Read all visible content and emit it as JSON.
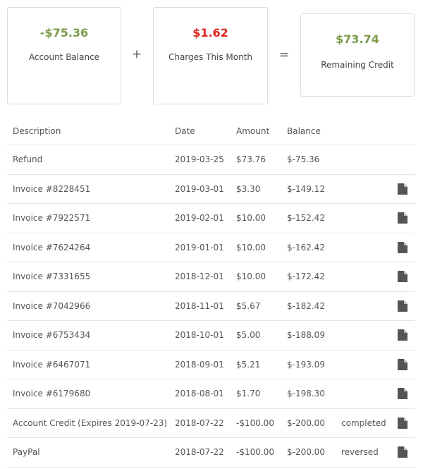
{
  "summary": {
    "account_balance": {
      "amount": "-$75.36",
      "label": "Account Balance"
    },
    "charges": {
      "amount": "$1.62",
      "label": "Charges This Month"
    },
    "remaining": {
      "amount": "$73.74",
      "label": "Remaining Credit"
    },
    "plus": "+",
    "equals": "="
  },
  "table": {
    "headers": {
      "description": "Description",
      "date": "Date",
      "amount": "Amount",
      "balance": "Balance"
    },
    "rows": [
      {
        "description": "Refund",
        "date": "2019-03-25",
        "amount": "$73.76",
        "balance": "$-75.36",
        "status": "",
        "icon": ""
      },
      {
        "description": "Invoice #8228451",
        "date": "2019-03-01",
        "amount": "$3.30",
        "balance": "$-149.12",
        "status": "",
        "icon": "document-icon"
      },
      {
        "description": "Invoice #7922571",
        "date": "2019-02-01",
        "amount": "$10.00",
        "balance": "$-152.42",
        "status": "",
        "icon": "document-icon"
      },
      {
        "description": "Invoice #7624264",
        "date": "2019-01-01",
        "amount": "$10.00",
        "balance": "$-162.42",
        "status": "",
        "icon": "document-icon"
      },
      {
        "description": "Invoice #7331655",
        "date": "2018-12-01",
        "amount": "$10.00",
        "balance": "$-172.42",
        "status": "",
        "icon": "document-icon"
      },
      {
        "description": "Invoice #7042966",
        "date": "2018-11-01",
        "amount": "$5.67",
        "balance": "$-182.42",
        "status": "",
        "icon": "document-icon"
      },
      {
        "description": "Invoice #6753434",
        "date": "2018-10-01",
        "amount": "$5.00",
        "balance": "$-188.09",
        "status": "",
        "icon": "document-icon"
      },
      {
        "description": "Invoice #6467071",
        "date": "2018-09-01",
        "amount": "$5.21",
        "balance": "$-193.09",
        "status": "",
        "icon": "document-icon"
      },
      {
        "description": "Invoice #6179680",
        "date": "2018-08-01",
        "amount": "$1.70",
        "balance": "$-198.30",
        "status": "",
        "icon": "document-icon"
      },
      {
        "description": "Account Credit (Expires 2019-07-23)",
        "date": "2018-07-22",
        "amount": "-$100.00",
        "balance": "$-200.00",
        "status": "completed",
        "icon": "document-icon"
      },
      {
        "description": "PayPal",
        "date": "2018-07-22",
        "amount": "-$100.00",
        "balance": "$-200.00",
        "status": "reversed",
        "icon": "document-icon"
      }
    ]
  },
  "colors": {
    "positive": "#7b9b4a",
    "negative": "#e0251f",
    "icon": "#555555"
  }
}
